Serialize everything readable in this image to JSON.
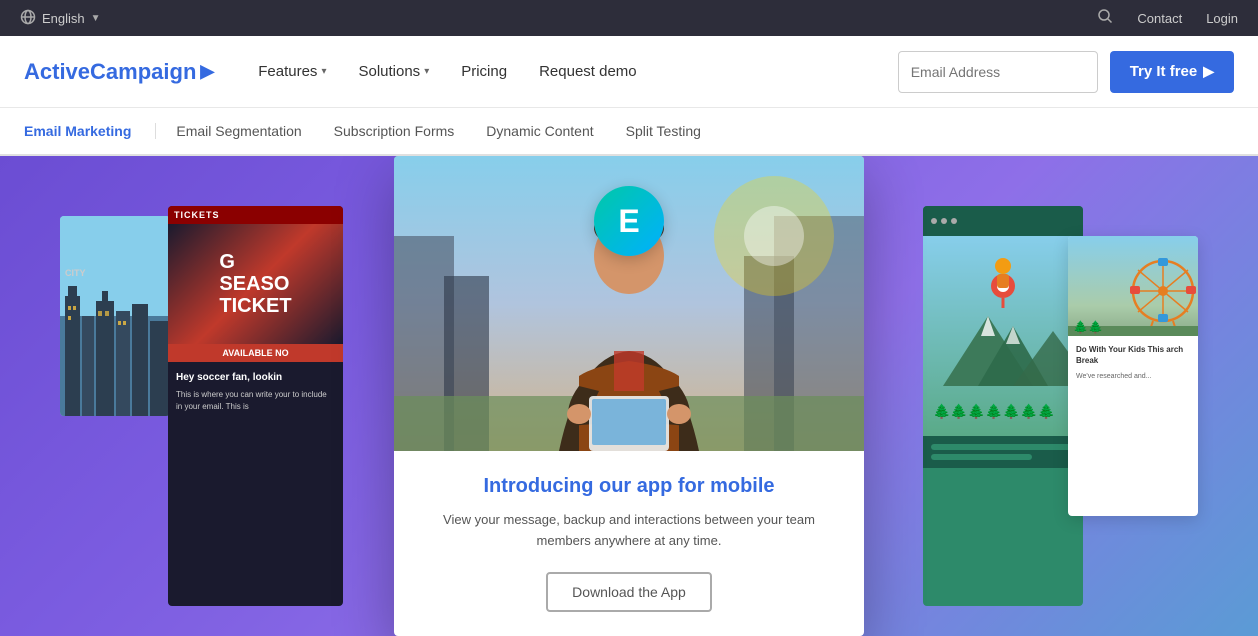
{
  "topbar": {
    "language": "English",
    "language_chevron": "▼",
    "contact_label": "Contact",
    "login_label": "Login",
    "search_icon": "🔍"
  },
  "navbar": {
    "logo_text": "ActiveCampaign",
    "logo_arrow": "▶",
    "nav_items": [
      {
        "label": "Features",
        "has_chevron": true
      },
      {
        "label": "Solutions",
        "has_chevron": true
      },
      {
        "label": "Pricing",
        "has_chevron": false
      },
      {
        "label": "Request demo",
        "has_chevron": false
      }
    ],
    "email_placeholder": "Email Address",
    "try_free_label": "Try It free",
    "try_free_arrow": "▶"
  },
  "subnav": {
    "title": "Email Marketing",
    "links": [
      {
        "label": "Email Segmentation"
      },
      {
        "label": "Subscription Forms"
      },
      {
        "label": "Dynamic Content"
      },
      {
        "label": "Split Testing"
      }
    ]
  },
  "hero": {
    "center_card": {
      "e_letter": "E",
      "title": "Introducing our app for mobile",
      "description": "View your message, backup and interactions between your team members anywhere at any time.",
      "download_btn": "Download the App"
    },
    "tickets_card": {
      "header": "TICKETS",
      "big_text_1": "G",
      "big_text_2": "SEASO",
      "big_text_3": "TICKET",
      "available": "AVAILABLE NO",
      "body_title": "Hey soccer fan, lookin",
      "body_text": "This is where you can write your to include in your email. This is"
    },
    "blog_card": {
      "title": "Do With Your Kids This arch Break",
      "text": "We've researched and..."
    },
    "city_label": "CITY"
  },
  "colors": {
    "purple_gradient_start": "#6b4dd3",
    "purple_gradient_end": "#5b9bd5",
    "blue_accent": "#356ae0",
    "teal_gradient": "#00c9a7"
  }
}
